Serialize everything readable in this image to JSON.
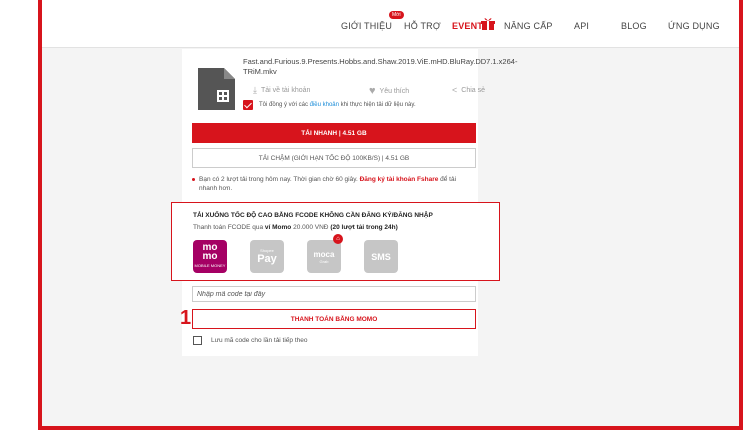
{
  "nav": {
    "items": [
      "GIỚI THIỆU",
      "HỖ TRỢ",
      "EVENT",
      "NÂNG CẤP",
      "API",
      "BLOG",
      "ỨNG DỤNG"
    ],
    "badge": "Mới"
  },
  "file": {
    "name": "Fast.and.Furious.9.Presents.Hobbs.and.Shaw.2019.ViE.mHD.BluRay.DD7.1.x264-TRiM.mkv",
    "actions": {
      "download_account": "Tải về tài khoản",
      "like": "Yêu thích",
      "share": "Chia sẻ"
    },
    "terms_prefix": "Tôi đồng ý với các ",
    "terms_link": "điều khoản",
    "terms_suffix": " khi thực hiện tải dữ liệu này."
  },
  "download": {
    "fast_label": "TẢI NHANH | 4.51 GB",
    "slow_label": "TẢI CHẬM (GIỚI HẠN TỐC ĐỘ 100KB/S) | 4.51 GB",
    "info_prefix": "Bạn có 2 lượt tải trong hôm nay. Thời gian chờ 60 giây. ",
    "info_link": "Đăng ký tài khoản Fshare",
    "info_suffix": " để tải nhanh hơn."
  },
  "promo": {
    "title": "TẢI XUỐNG TỐC ĐỘ CAO BẰNG FCODE KHÔNG CẦN ĐĂNG KÝ/ĐĂNG NHẬP",
    "sub_prefix": "Thanh toán FCODE qua ",
    "sub_method": "ví Momo",
    "sub_price": " 20.000 VNĐ ",
    "sub_turns": "(20 lượt tải trong 24h)",
    "methods": {
      "momo_top": "mo",
      "momo_bottom": "mo",
      "momo_small": "MOBILE MONEY",
      "shopee_small": "Shopee",
      "shopee": "Pay",
      "moca": "moca",
      "moca_small": "Grab",
      "sms": "SMS"
    }
  },
  "code": {
    "placeholder": "Nhập mã code tại đây",
    "pay_button": "THANH TOÁN BẰNG MOMO",
    "save_label": "Lưu mã code cho lần tải tiếp theo"
  },
  "annotation": {
    "step": "1"
  },
  "colors": {
    "brand_red": "#d7141c",
    "momo": "#a50064"
  }
}
